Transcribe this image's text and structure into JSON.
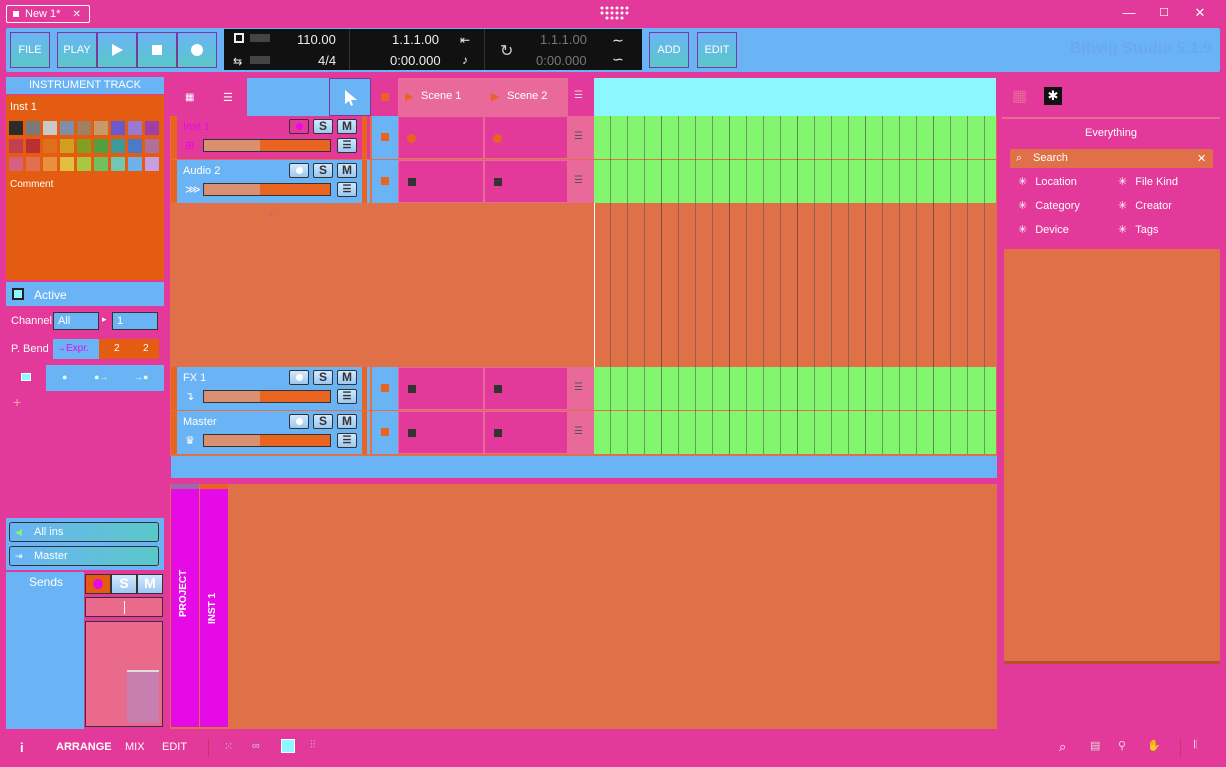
{
  "window": {
    "tab_title": "New 1*",
    "tab_close": "✕",
    "minimize": "—",
    "maximize": "☐",
    "close": "✕"
  },
  "transport": {
    "file": "FILE",
    "play": "PLAY",
    "add": "ADD",
    "edit": "EDIT",
    "tempo": "110.00",
    "signature": "4/4",
    "position_bars": "1.1.1.00",
    "position_time": "0:00.000",
    "loop_bars": "1.1.1.00",
    "loop_time": "0:00.000",
    "brand": "Bitwig Studio 5.1.9"
  },
  "inspector": {
    "header": "INSTRUMENT TRACK",
    "track_name": "Inst 1",
    "comment": "Comment",
    "active": "Active",
    "channel_label": "Channel",
    "channel_value": "All",
    "channel_num": "1",
    "pbend_label": "P. Bend",
    "pbend_expr": "→Expr.",
    "pbend_a": "2",
    "pbend_b": "2",
    "input": "All ins",
    "output": "Master",
    "sends": "Sends",
    "solo": "S",
    "mute": "M",
    "swatches": [
      "#2b2b2b",
      "#7a7a7a",
      "#c8c8c8",
      "#7f8fa8",
      "#a08060",
      "#c89a6a",
      "#6a5acd",
      "#9a7ad0",
      "#a040a0",
      "#c04050",
      "#b83030",
      "#e07020",
      "#d0a020",
      "#80a020",
      "#50a040",
      "#3c9a9a",
      "#4a7ac8",
      "#b0709a",
      "#d66080",
      "#e07050",
      "#e89040",
      "#e0c040",
      "#a8c840",
      "#70c060",
      "#70c8b0",
      "#70b0e8",
      "#c8a0e0"
    ]
  },
  "arranger": {
    "scenes": [
      "Scene 1",
      "Scene 2"
    ],
    "tracks": [
      {
        "name": "Inst 1",
        "icon": "piano-icon"
      },
      {
        "name": "Audio 2",
        "icon": "waveform-icon"
      },
      {
        "name": "FX 1",
        "icon": "fx-return-icon"
      },
      {
        "name": "Master",
        "icon": "crown-icon"
      }
    ],
    "solo": "S",
    "mute": "M"
  },
  "browser": {
    "title": "Everything",
    "search_placeholder": "Search",
    "filters": [
      "Location",
      "File Kind",
      "Category",
      "Creator",
      "Device",
      "Tags"
    ]
  },
  "panel_tabs": {
    "project": "PROJECT",
    "inst": "INST 1"
  },
  "bottom": {
    "info": "i",
    "arrange": "ARRANGE",
    "mix": "MIX",
    "edit": "EDIT"
  },
  "colors": {
    "pink": "#e2399a",
    "blue": "#6ab4f5",
    "orange": "#e96420",
    "green": "#83f66f",
    "cyan": "#8cf7ff",
    "magenta": "#e60be6",
    "clay": "#e07048"
  }
}
